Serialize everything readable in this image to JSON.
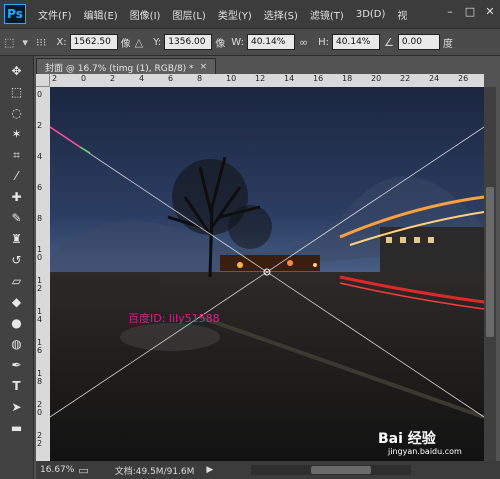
{
  "menubar": {
    "logo": "Ps",
    "items": [
      "文件(F)",
      "编辑(E)",
      "图像(I)",
      "图层(L)",
      "类型(Y)",
      "选择(S)",
      "滤镜(T)",
      "3D(D)",
      "视"
    ]
  },
  "options": {
    "x_label": "X:",
    "x_value": "1562.50",
    "x_unit": "像",
    "y_label": "Y:",
    "y_value": "1356.00",
    "y_unit": "像",
    "w_label": "W:",
    "w_value": "40.14%",
    "h_label": "H:",
    "h_value": "40.14%",
    "angle_value": "0.00",
    "angle_unit": "度"
  },
  "tab": {
    "title": "封面 @ 16.7% (timg (1), RGB/8) *",
    "close": "×"
  },
  "ruler": {
    "h_ticks": [
      "2",
      "0",
      "2",
      "4",
      "6",
      "8",
      "10",
      "12",
      "14",
      "16",
      "18",
      "20",
      "22",
      "24",
      "26"
    ],
    "v_ticks": [
      "0",
      "2",
      "4",
      "6",
      "8",
      "1\n0",
      "1\n2",
      "1\n4",
      "1\n6",
      "1\n8",
      "2\n0",
      "2\n2"
    ]
  },
  "status": {
    "zoom": "16.67%",
    "doc": "文档:49.5M/91.6M",
    "arrow": "▶"
  },
  "watermark": {
    "text": "百度ID: lily51588",
    "logo": "Bai 经验",
    "url": "jingyan.baidu.com"
  },
  "colors": {
    "menubar_bg": "#3c3c3c",
    "options_bg": "#4b4b4b",
    "toolbar_bg": "#424242",
    "ps_accent": "#31a8ff"
  }
}
